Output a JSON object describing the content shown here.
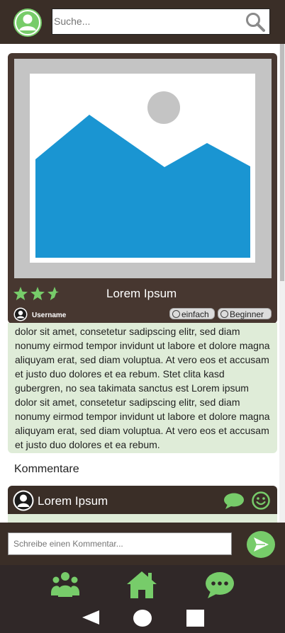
{
  "search": {
    "placeholder": "Suche..."
  },
  "post": {
    "title": "Lorem Ipsum",
    "rating": 2.5,
    "rating_max": 3,
    "username": "Username",
    "tags": [
      "einfach",
      "Beginner"
    ],
    "description": "dolor sit amet, consetetur sadipscing elitr, sed diam nonumy eirmod tempor invidunt ut labore et dolore magna aliquyam erat, sed diam voluptua. At vero eos et accusam et justo duo dolores et ea rebum. Stet clita kasd gubergren, no sea takimata sanctus est Lorem ipsum dolor sit amet, consetetur sadipscing elitr, sed diam nonumy eirmod tempor invidunt ut labore et dolore magna aliquyam erat, sed diam voluptua. At vero eos et accusam et justo duo dolores et ea rebum."
  },
  "comments": {
    "heading": "Kommentare",
    "items": [
      {
        "author": "Lorem Ipsum"
      }
    ],
    "input_placeholder": "Schreibe einen Kommentar..."
  },
  "colors": {
    "bar": "#3a2e27",
    "card": "#473730",
    "accent": "#77cc6a",
    "desc_bg": "#dfecd8",
    "image_blue": "#1a95d2"
  },
  "icons": [
    "avatar-icon",
    "search-icon",
    "star-icon",
    "user-icon",
    "speech-bubble-icon",
    "smiley-icon",
    "send-icon",
    "users-icon",
    "home-icon",
    "chat-icon",
    "back-icon",
    "circle-home-icon",
    "square-recent-icon"
  ]
}
